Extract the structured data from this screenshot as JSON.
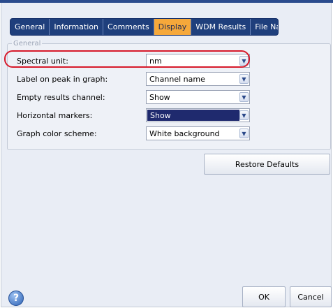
{
  "tabs": [
    {
      "label": "General"
    },
    {
      "label": "Information"
    },
    {
      "label": "Comments"
    },
    {
      "label": "Display",
      "active": true
    },
    {
      "label": "WDM Results"
    },
    {
      "label": "File Name"
    }
  ],
  "group": {
    "legend": "General",
    "rows": [
      {
        "label": "Spectral unit:",
        "value": "nm"
      },
      {
        "label": "Label on peak in graph:",
        "value": "Channel name"
      },
      {
        "label": "Empty results channel:",
        "value": "Show"
      },
      {
        "label": "Horizontal markers:",
        "value": "Show"
      },
      {
        "label": "Graph color scheme:",
        "value": "White background"
      }
    ]
  },
  "buttons": {
    "restore_defaults": "Restore Defaults",
    "ok": "OK",
    "cancel": "Cancel",
    "help": "?"
  },
  "colors": {
    "tab_bar": "#1f3f7c",
    "active_tab": "#f6a83a",
    "highlight_ring": "#d7192a",
    "selected_value": "#1f2a6e"
  },
  "icons": {
    "dropdown": "chevron-down-icon",
    "help": "help-icon"
  }
}
